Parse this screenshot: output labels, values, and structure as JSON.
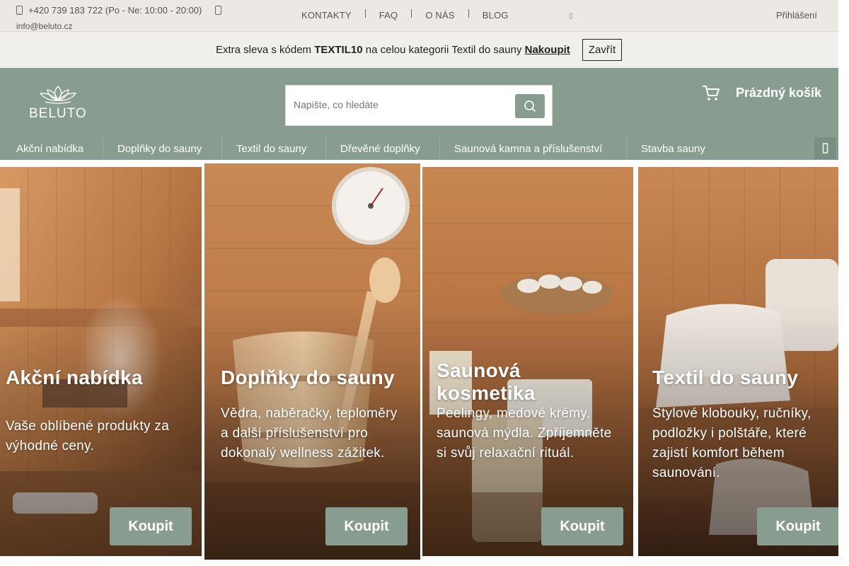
{
  "topbar": {
    "phone": "+420 739 183 722 (Po - Ne: 10:00 - 20:00)",
    "email": "info@beluto.cz",
    "links": [
      "KONTAKTY",
      "FAQ",
      "O NÁS",
      "BLOG"
    ],
    "login": "Přihlášení",
    "icons": {
      "phone": "phone-icon",
      "email": "mail-icon"
    }
  },
  "promo": {
    "prefix": "Extra sleva s kódem ",
    "code": "TEXTIL10",
    "middle": " na celou kategorii Textil do sauny ",
    "link": "Nakoupit",
    "close": "Zavřít"
  },
  "header": {
    "logo_text": "BELUTO",
    "search_placeholder": "Napište, co hledáte",
    "cart_label": "Prázdný košík"
  },
  "nav": {
    "items": [
      "Akční nabídka",
      "Doplňky do sauny",
      "Textil do sauny",
      "Dřevěné doplňky",
      "Saunová kamna a příslušenství",
      "Stavba sauny"
    ]
  },
  "cards": [
    {
      "title": "Akční nabídka",
      "text": "Vaše oblíbené produkty za výhodné ceny.",
      "button": "Koupit"
    },
    {
      "title": "Doplňky do sauny",
      "text": "Vědra, naběračky, teploměry a další příslušenství pro dokonalý wellness zážitek.",
      "button": "Koupit"
    },
    {
      "title": "Saunová kosmetika",
      "text": "Peelingy, medové krémy, saunová mýdla. Zpříjemněte si svůj relaxační rituál.",
      "button": "Koupit"
    },
    {
      "title": "Textil do sauny",
      "text": "Stylové klobouky, ručníky, podložky i polštáře, které zajistí komfort během saunování.",
      "button": "Koupit"
    }
  ],
  "colors": {
    "brand_green": "#889d8f",
    "topbar_bg": "#ece8e3",
    "promo_bg": "#f1efec",
    "wood": "#c58a56"
  }
}
